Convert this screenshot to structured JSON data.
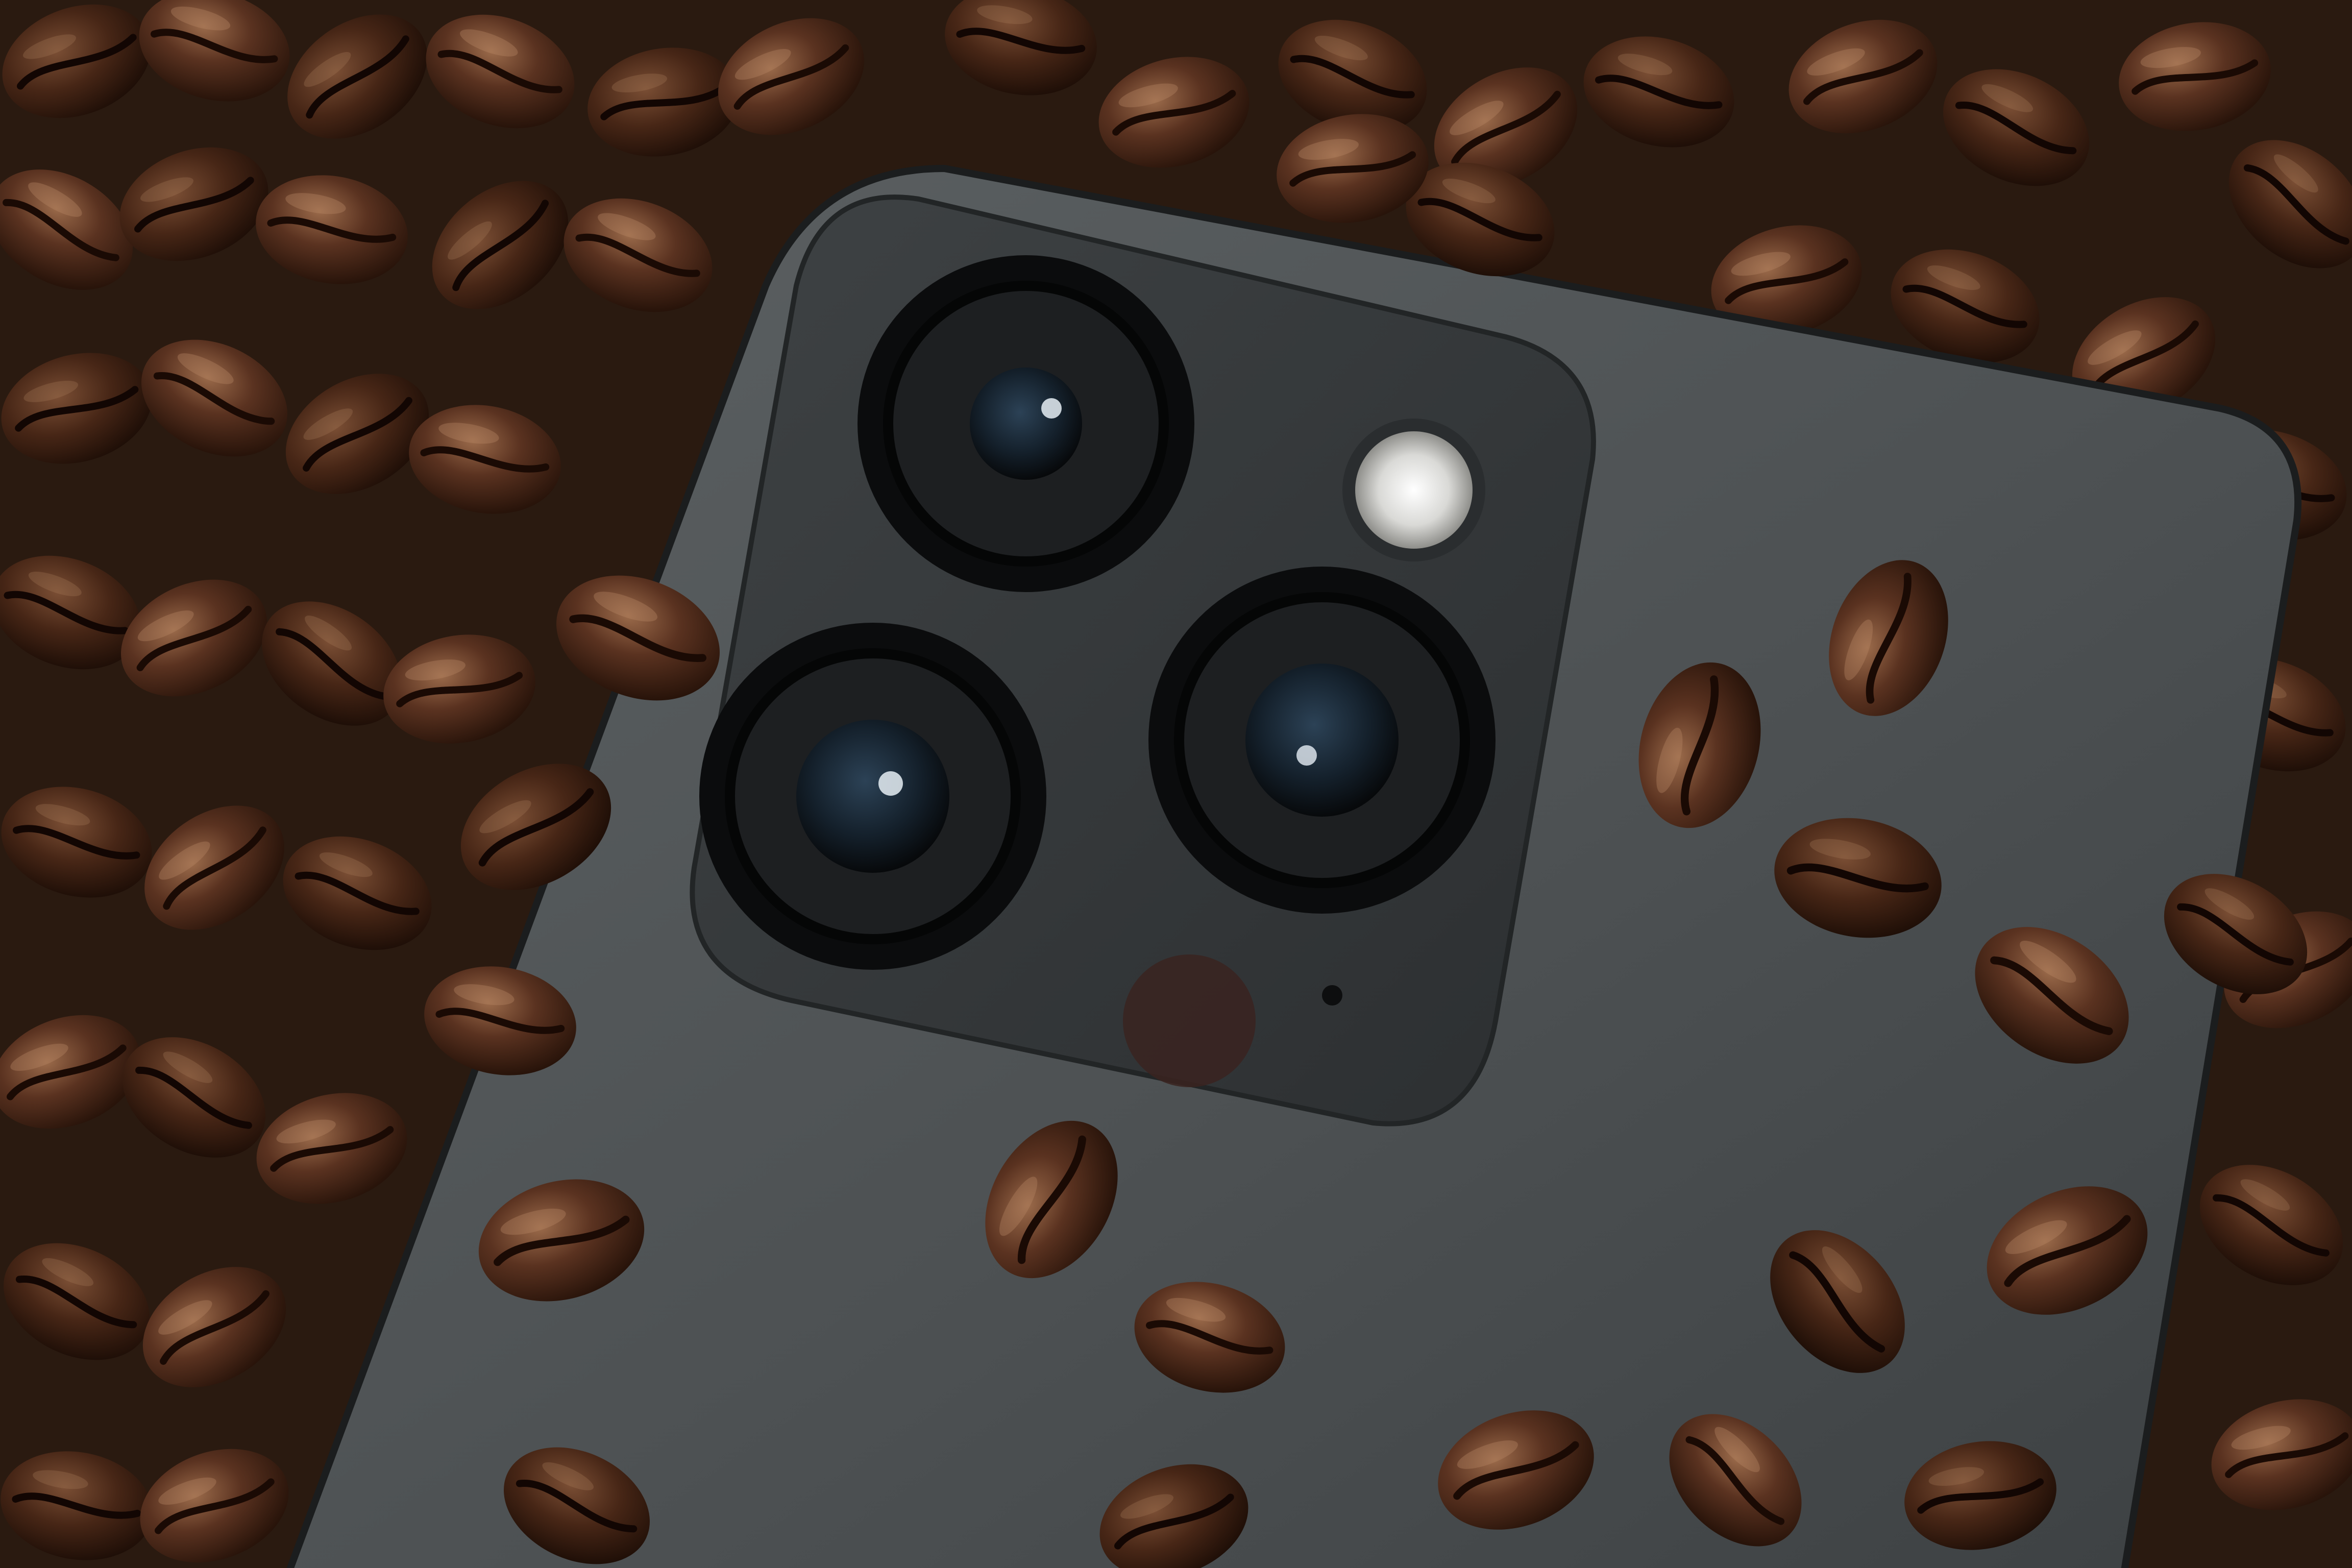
{
  "scene": {
    "subject": "phone-back-camera",
    "background_texture": "roasted-coffee-beans",
    "palette": {
      "bean_dark": "#2b160b",
      "bean_mid": "#5a3220",
      "bean_light": "#8a5a3c",
      "bean_highlight": "#c79a78",
      "phone_body": "#4a4e50",
      "phone_body_light": "#5b6062",
      "camera_plate": "#34383a",
      "lens_ring": "#0e0f10",
      "lens_glass": "#1a2a38",
      "flash": "#e8e8e6"
    },
    "camera": {
      "lenses": [
        "lens-top",
        "lens-bottom-left",
        "lens-bottom-right"
      ],
      "flash": "flash",
      "microphone": "microphone-hole",
      "lidar": "lidar-sensor"
    }
  }
}
